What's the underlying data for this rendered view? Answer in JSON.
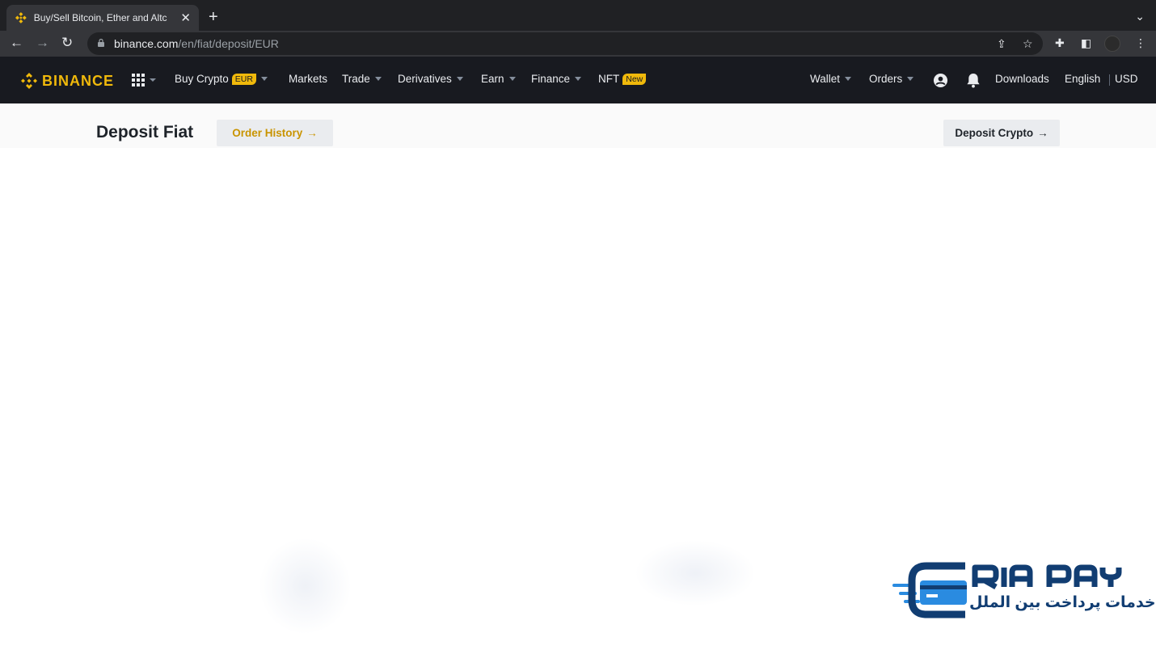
{
  "browser": {
    "tab_title": "Buy/Sell Bitcoin, Ether and Altc",
    "url_host": "binance.com",
    "url_path": "/en/fiat/deposit/EUR"
  },
  "header": {
    "logo_text": "BINANCE",
    "nav": {
      "buy_crypto": "Buy Crypto",
      "buy_crypto_badge": "EUR",
      "markets": "Markets",
      "trade": "Trade",
      "derivatives": "Derivatives",
      "earn": "Earn",
      "finance": "Finance",
      "nft": "NFT",
      "nft_badge": "New"
    },
    "right": {
      "wallet": "Wallet",
      "orders": "Orders",
      "downloads": "Downloads",
      "language": "English",
      "currency": "USD"
    }
  },
  "subheader": {
    "title": "Deposit Fiat",
    "order_history": "Order History",
    "deposit_crypto": "Deposit Crypto",
    "arrow": "→"
  },
  "watermark": {
    "brand": "ERIA PAY",
    "subtitle": "خدمات پرداخت بین الملل"
  },
  "colors": {
    "brand_yellow": "#f0b90b",
    "header_bg": "#181a20",
    "watermark_blue": "#113d72",
    "watermark_light": "#2a8be0"
  }
}
